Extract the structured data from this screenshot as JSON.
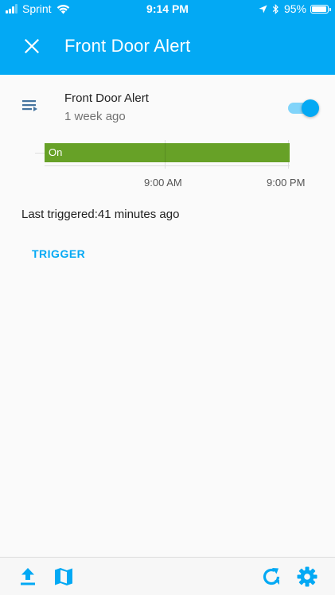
{
  "status_bar": {
    "carrier": "Sprint",
    "time": "9:14 PM",
    "battery_percent": "95%",
    "battery_level": 0.95,
    "icons": [
      "signal-icon",
      "wifi-icon",
      "location-arrow-icon",
      "bluetooth-icon",
      "battery-icon"
    ]
  },
  "header": {
    "title": "Front Door Alert",
    "close_icon": "close-icon",
    "background_color": "#03a9f4"
  },
  "entity": {
    "name": "Front Door Alert",
    "last_changed": "1 week ago",
    "icon": "playlist-icon",
    "toggle_on": true
  },
  "timeline": {
    "state_label": "On",
    "state_color": "#67a127",
    "ticks": [
      "9:00 AM",
      "9:00 PM"
    ]
  },
  "last_triggered": "Last triggered:41 minutes ago",
  "actions": {
    "trigger_label": "TRIGGER"
  },
  "toolbar": {
    "icons": [
      "upload-icon",
      "map-icon",
      "refresh-icon",
      "settings-icon"
    ],
    "accent_color": "#03a9f4"
  }
}
